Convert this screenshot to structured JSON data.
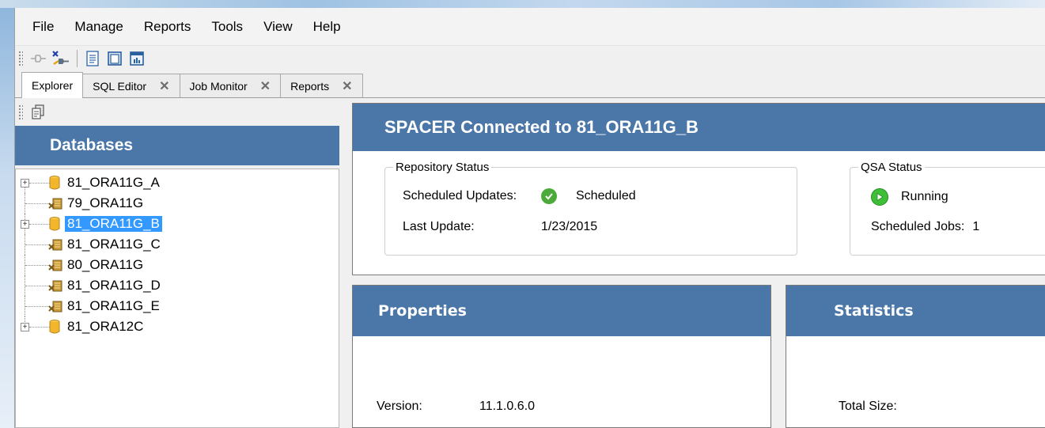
{
  "menu": {
    "items": [
      "File",
      "Manage",
      "Reports",
      "Tools",
      "View",
      "Help"
    ]
  },
  "toolbar": {
    "icons": [
      "connect-icon",
      "disconnect-icon",
      "document-icon",
      "window-icon",
      "report-icon"
    ]
  },
  "tabs": [
    {
      "label": "Explorer",
      "active": true,
      "closable": false
    },
    {
      "label": "SQL Editor",
      "active": false,
      "closable": true
    },
    {
      "label": "Job Monitor",
      "active": false,
      "closable": true
    },
    {
      "label": "Reports",
      "active": false,
      "closable": true
    }
  ],
  "tab_close_glyph": "✕",
  "databases": {
    "title": "Databases",
    "items": [
      {
        "label": "81_ORA11G_A",
        "expandable": true,
        "icon": "database-icon",
        "selected": false
      },
      {
        "label": "79_ORA11G",
        "expandable": false,
        "icon": "database-agent-icon",
        "selected": false
      },
      {
        "label": "81_ORA11G_B",
        "expandable": true,
        "icon": "database-icon",
        "selected": true
      },
      {
        "label": "81_ORA11G_C",
        "expandable": false,
        "icon": "database-agent-icon",
        "selected": false
      },
      {
        "label": "80_ORA11G",
        "expandable": false,
        "icon": "database-agent-icon",
        "selected": false
      },
      {
        "label": "81_ORA11G_D",
        "expandable": false,
        "icon": "database-agent-icon",
        "selected": false
      },
      {
        "label": "81_ORA11G_E",
        "expandable": false,
        "icon": "database-agent-icon",
        "selected": false
      },
      {
        "label": "81_ORA12C",
        "expandable": true,
        "icon": "database-icon",
        "selected": false
      }
    ]
  },
  "connection": {
    "title": "SPACER Connected to 81_ORA11G_B"
  },
  "repository_status": {
    "legend": "Repository Status",
    "scheduled_updates_label": "Scheduled Updates:",
    "scheduled_updates_value": "Scheduled",
    "last_update_label": "Last Update:",
    "last_update_value": "1/23/2015"
  },
  "qsa_status": {
    "legend": "QSA Status",
    "state": "Running",
    "scheduled_jobs_label": "Scheduled Jobs:",
    "scheduled_jobs_value": "1"
  },
  "properties": {
    "title": "Properties",
    "version_label": "Version:",
    "version_value": "11.1.0.6.0"
  },
  "statistics": {
    "title": "Statistics",
    "total_size_label": "Total Size:"
  },
  "colors": {
    "header_blue": "#4a76a8",
    "selection_blue": "#3399ff",
    "ok_green": "#4caa3a"
  }
}
